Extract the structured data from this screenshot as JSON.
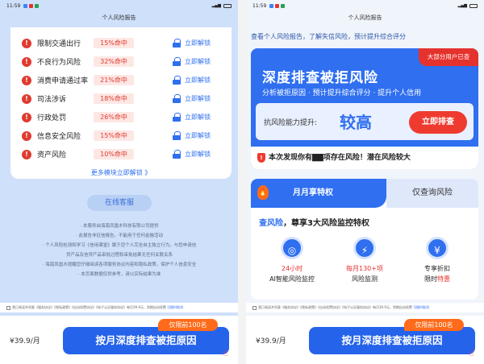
{
  "left": {
    "status": {
      "time": "11:59"
    },
    "title": "个人风险报告",
    "risks": [
      {
        "name": "限制交通出行",
        "hit": "15%命中",
        "action": "立即解锁"
      },
      {
        "name": "不良行为风险",
        "hit": "32%命中",
        "action": "立即解锁"
      },
      {
        "name": "消费申请通过率",
        "hit": "21%命中",
        "action": "立即解锁"
      },
      {
        "name": "司法涉诉",
        "hit": "18%命中",
        "action": "立即解锁"
      },
      {
        "name": "行政处罚",
        "hit": "26%命中",
        "action": "立即解锁"
      },
      {
        "name": "信息安全风险",
        "hit": "15%命中",
        "action": "立即解锁"
      },
      {
        "name": "资产风险",
        "hit": "10%命中",
        "action": "立即解锁"
      }
    ],
    "more_link": "更多模块立即解锁 》",
    "service_button": "在线客服",
    "disclaimer": [
      "· 本服务由海南凤凰木科技有限公司提供",
      "· 此报告非征信报告，不能用于任何金融活动",
      "· 个人风险检测和学习《信用课堂》属于您个人完全自主独立行为，与您申请信",
      "贷产品及信贷产品审批过程和审批结果无任何关联关系",
      "· 海南凤凰木提醒您仔细阅读各项服务协议内容和隐私政策，保护个人信息安全",
      "· 本页面数据仅供参考，请以实际结果为准"
    ],
    "agree_text": "我已阅读并同意《服务协议》《隐私政策》《自动续费协议》《电子认证服务协议》每月39.9元，到期自动续费",
    "agree_link": "可随时取消",
    "price": "¥39.9/月",
    "cta": "按月深度排查被拒原因",
    "limit_badge": "仅限前100名"
  },
  "right": {
    "status": {
      "time": "11:59"
    },
    "title": "个人风险报告",
    "description": "查看个人风险报告，了解失信风险，预计提升综合评分",
    "hero": {
      "tag": "大部分用户已查",
      "title": "深度排查被拒风险",
      "subtitle": "分析被拒原因 · 预计提升综合评分 · 提升个人信用",
      "ability_label": "抗风险能力提升:",
      "ability_value": "较高",
      "check_button": "立即排查",
      "alert": "本次发现你有▇▇项存在风险！潜在风险较大"
    },
    "tabs": [
      "月月享特权",
      "仅查询风险"
    ],
    "feature_title_accent": "查风险",
    "feature_title_rest": "，尊享3大风险监控特权",
    "features": [
      {
        "icon": "◎",
        "line1": "24小时",
        "line2": "AI智能风险监控",
        "line2_red": ""
      },
      {
        "icon": "⚡",
        "line1": "每月130+项",
        "line2": "风险监测",
        "line2_red": ""
      },
      {
        "icon": "¥",
        "line1": "专享折扣",
        "line2": "限时",
        "line2_red": "特惠"
      }
    ],
    "agree_text": "我已阅读并同意《服务协议》《隐私政策》《自动续费协议》《电子认证服务协议》每月39.9元，到期自动续费",
    "agree_link": "可随时取消",
    "price": "¥39.9/月",
    "cta": "按月深度排查被拒原因",
    "limit_badge": "仅限前100名"
  }
}
